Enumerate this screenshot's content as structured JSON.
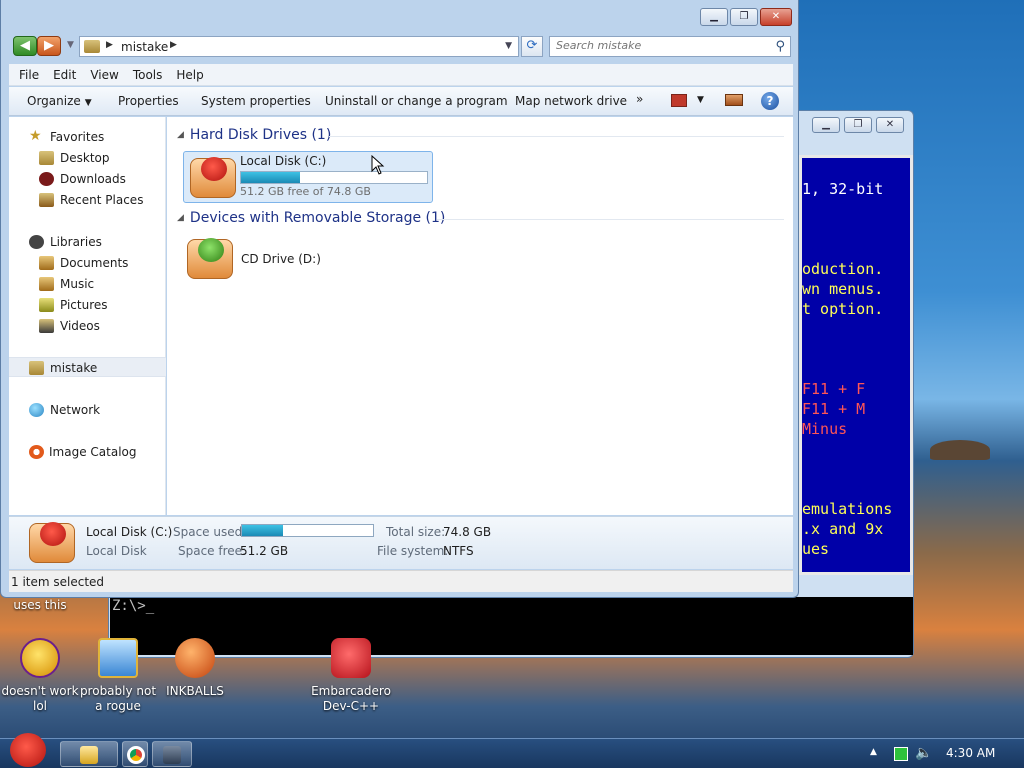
{
  "explorer": {
    "address_crumb": "mistake",
    "search_placeholder": "Search mistake",
    "menu": [
      "File",
      "Edit",
      "View",
      "Tools",
      "Help"
    ],
    "commands": {
      "organize": "Organize",
      "properties": "Properties",
      "system_properties": "System properties",
      "uninstall": "Uninstall or change a program",
      "map_drive": "Map network drive",
      "more": "»"
    },
    "nav": {
      "favorites": "Favorites",
      "desktop": "Desktop",
      "downloads": "Downloads",
      "recent_places": "Recent Places",
      "libraries": "Libraries",
      "documents": "Documents",
      "music": "Music",
      "pictures": "Pictures",
      "videos": "Videos",
      "computer": "mistake",
      "network": "Network",
      "image_catalog": "Image Catalog"
    },
    "groups": {
      "hdd": "Hard Disk Drives (1)",
      "removable": "Devices with Removable Storage (1)"
    },
    "drive_c": {
      "name": "Local Disk (C:)",
      "free_text": "51.2 GB free of 74.8 GB",
      "used_fraction": 0.315
    },
    "drive_d": {
      "name": "CD Drive (D:)"
    },
    "details": {
      "name": "Local Disk (C:)",
      "type": "Local Disk",
      "space_used_label": "Space used:",
      "space_free_label": "Space free:",
      "space_free": "51.2 GB",
      "total_label": "Total size:",
      "total": "74.8 GB",
      "fs_label": "File system:",
      "fs": "NTFS",
      "used_fraction": 0.315
    },
    "status": "1 item selected"
  },
  "console": {
    "lines": [
      {
        "text": "1, 32-bit",
        "color": "#ffffff"
      },
      {
        "text": "oduction.",
        "color": "#ffff55"
      },
      {
        "text": "wn menus.",
        "color": "#ffff55"
      },
      {
        "text": "t option.",
        "color": "#ffff55"
      },
      {
        "text": " F11 + F",
        "color": "#ff5555"
      },
      {
        "text": "F11 + M",
        "color": "#ff5555"
      },
      {
        "text": " Minus",
        "color": "#ff5555"
      },
      {
        "text": "emulations",
        "color": "#ffff55"
      },
      {
        "text": ".x and 9x",
        "color": "#ffff55"
      },
      {
        "text": "ues",
        "color": "#ffff55"
      }
    ],
    "prompt": "Z:\\>_"
  },
  "desktop_icons": {
    "partial_label": "uses this",
    "yahoo": "doesn't work lol",
    "rogue": "probably not a rogue",
    "inkballs": "INKBALLS",
    "devcpp": "Embarcadero Dev-C++"
  },
  "taskbar": {
    "clock": "4:30 AM"
  }
}
